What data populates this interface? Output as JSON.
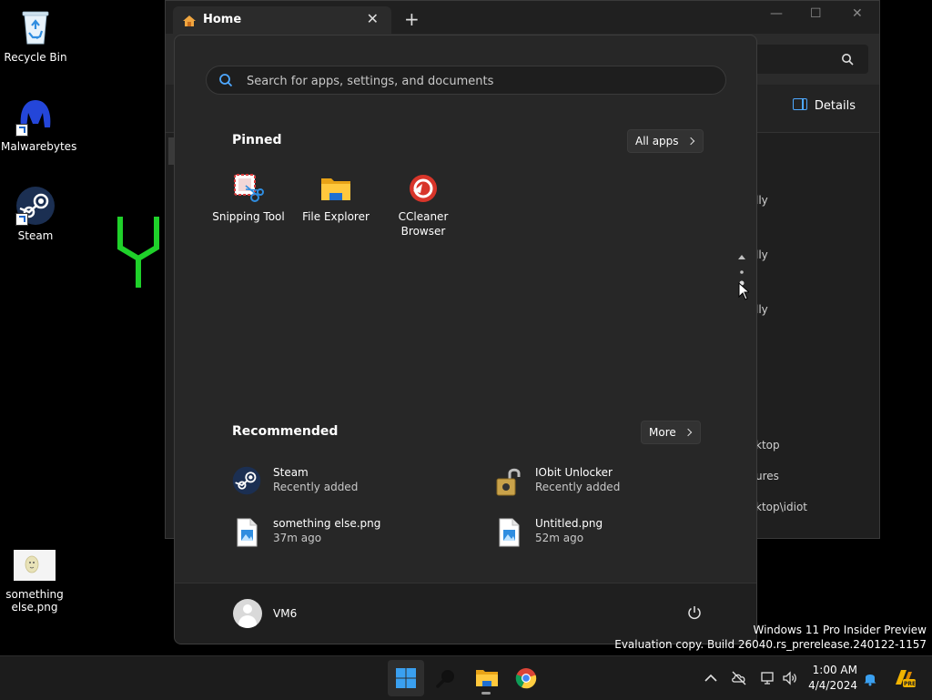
{
  "desktop": {
    "icons": [
      {
        "label": "Recycle Bin"
      },
      {
        "label": "Malwarebytes"
      },
      {
        "label": "Steam"
      },
      {
        "label": "something else.png"
      }
    ]
  },
  "explorer": {
    "tab_title": "Home",
    "details_label": "Details",
    "fragments": [
      "lly",
      "lly",
      "lly",
      "ktop",
      "ures",
      "ktop\\idiot"
    ]
  },
  "start_menu": {
    "search": {
      "placeholder": "Search for apps, settings, and documents"
    },
    "pinned": {
      "title": "Pinned",
      "all_apps_label": "All apps",
      "apps": [
        {
          "label": "Snipping Tool",
          "icon": "snipping-tool-icon"
        },
        {
          "label": "File Explorer",
          "icon": "folder-icon"
        },
        {
          "label": "CCleaner Browser",
          "icon": "ccleaner-icon"
        }
      ]
    },
    "recommended": {
      "title": "Recommended",
      "more_label": "More",
      "items": [
        {
          "name": "Steam",
          "sub": "Recently added",
          "icon": "steam-icon"
        },
        {
          "name": "IObit Unlocker",
          "sub": "Recently added",
          "icon": "unlock-icon"
        },
        {
          "name": "something else.png",
          "sub": "37m ago",
          "icon": "image-file-icon"
        },
        {
          "name": "Untitled.png",
          "sub": "52m ago",
          "icon": "image-file-icon"
        }
      ]
    },
    "user": {
      "name": "VM6"
    }
  },
  "taskbar": {
    "clock": {
      "time": "1:00 AM",
      "date": "4/4/2024"
    },
    "apps": [
      "start-icon",
      "search-icon",
      "folder-icon",
      "chrome-icon"
    ]
  },
  "watermark": {
    "line1": "Windows 11 Pro Insider Preview",
    "line2": "Evaluation copy. Build 26040.rs_prerelease.240122-1157"
  },
  "colors": {
    "accent": "#4ea8ff",
    "start_bg": "#272727",
    "taskbar_bg": "#1c1c1c"
  }
}
